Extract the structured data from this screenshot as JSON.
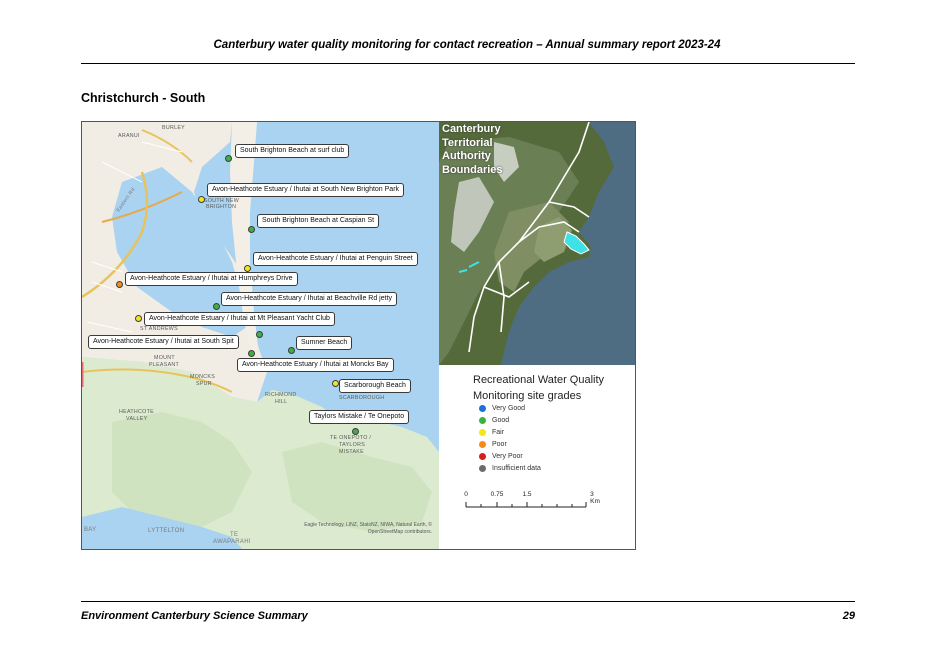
{
  "header": {
    "title": "Canterbury water quality monitoring for contact recreation – Annual summary report 2023-24"
  },
  "section_title": "Christchurch - South",
  "inset": {
    "title_lines": [
      "Canterbury",
      "Territorial",
      "Authority",
      "Boundaries"
    ]
  },
  "map": {
    "places": {
      "aranui": "ARANUI",
      "burley": "BURLEY",
      "south_new_brighton": "SOUTH NEW",
      "brighton": "BRIGHTON",
      "st_andrews": "ST ANDREWS",
      "mount": "MOUNT",
      "pleasant": "PLEASANT",
      "moncks": "MONCKS",
      "spur": "SPUR",
      "richmond": "RICHMOND",
      "hill": "HILL",
      "scarborough": "SCARBOROUGH",
      "heathcote": "HEATHCOTE",
      "valley": "VALLEY",
      "te_onepoto": "TE ONEPOTO /",
      "taylors": "TAYLORS",
      "mistake": "MISTAKE",
      "lyttelton": "LYTTELTON",
      "te": "TE",
      "awaparahi": "AWAPARAHI",
      "bay": "BAY",
      "eastern_rd": "Eastern Rd"
    },
    "attribution_line1": "Eagle Technology, LINZ, StatsNZ, NIWA, Natural Earth, ©",
    "attribution_line2": "OpenStreetMap contributors.",
    "sites": [
      {
        "label": "South Brighton Beach at surf club",
        "grade": "Good",
        "color": "#3cb043"
      },
      {
        "label": "Avon-Heathcote Estuary / Ihutai at South New Brighton Park",
        "grade": "Fair",
        "color": "#f2e61c"
      },
      {
        "label": "South Brighton Beach at Caspian St",
        "grade": "Good",
        "color": "#3cb043"
      },
      {
        "label": "Avon-Heathcote Estuary / Ihutai at Penguin Street",
        "grade": "Fair",
        "color": "#f2e61c"
      },
      {
        "label": "Avon-Heathcote Estuary / Ihutai at Humphreys Drive",
        "grade": "Poor",
        "color": "#f08c1c"
      },
      {
        "label": "Avon-Heathcote Estuary / Ihutai at Beachville Rd jetty",
        "grade": "Good",
        "color": "#3cb043"
      },
      {
        "label": "Avon-Heathcote Estuary / Ihutai at Mt Pleasant Yacht Club",
        "grade": "Fair",
        "color": "#f2e61c"
      },
      {
        "label": "Avon-Heathcote Estuary / Ihutai at South Spit",
        "grade": "Good",
        "color": "#3cb043"
      },
      {
        "label": "Sumner Beach",
        "grade": "Good",
        "color": "#3cb043"
      },
      {
        "label": "Avon-Heathcote Estuary / Ihutai at Moncks Bay",
        "grade": "Good",
        "color": "#3cb043"
      },
      {
        "label": "Scarborough Beach",
        "grade": "Fair",
        "color": "#f2e61c"
      },
      {
        "label": "Taylors Mistake / Te Onepoto",
        "grade": "Good",
        "color": "#3cb043"
      }
    ]
  },
  "legend": {
    "title_line1": "Recreational Water Quality",
    "title_line2": "Monitoring site grades",
    "items": [
      {
        "label": "Very Good",
        "color": "#1f6fd6"
      },
      {
        "label": "Good",
        "color": "#3cb043"
      },
      {
        "label": "Fair",
        "color": "#f2e61c"
      },
      {
        "label": "Poor",
        "color": "#f08c1c"
      },
      {
        "label": "Very Poor",
        "color": "#d21f1f"
      },
      {
        "label": "Insufficient data",
        "color": "#6b6b6b"
      }
    ],
    "scale_labels": [
      "0",
      "0.75",
      "1.5",
      "3 Km"
    ]
  },
  "footer": {
    "left": "Environment Canterbury Science Summary",
    "page": "29"
  }
}
